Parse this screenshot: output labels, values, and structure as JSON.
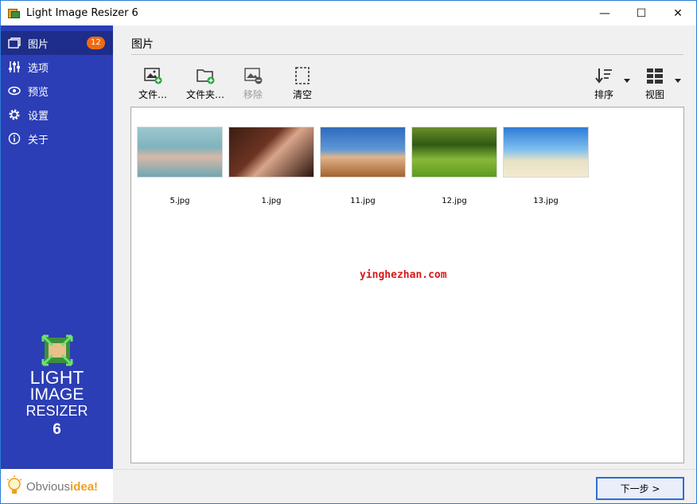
{
  "window": {
    "title": "Light Image Resizer 6",
    "controls": {
      "minimize": "—",
      "maximize": "☐",
      "close": "✕"
    }
  },
  "sidebar": {
    "items": [
      {
        "label": "图片",
        "icon": "images-icon",
        "badge": "12",
        "active": true
      },
      {
        "label": "选项",
        "icon": "sliders-icon"
      },
      {
        "label": "预览",
        "icon": "eye-icon"
      },
      {
        "label": "设置",
        "icon": "gear-icon"
      },
      {
        "label": "关于",
        "icon": "info-icon"
      }
    ],
    "logo": {
      "line1": "LIGHT",
      "line2": "IMAGE",
      "line3": "RESIZER",
      "line4": "6"
    },
    "footer": {
      "brand_prefix": "Obvious",
      "brand_accent": "idea!"
    }
  },
  "main": {
    "heading": "图片",
    "toolbar": {
      "add_files": "文件…",
      "add_folder": "文件夹…",
      "remove": "移除",
      "clear": "清空",
      "sort": "排序",
      "view": "视图"
    },
    "images": [
      {
        "name": "5.jpg"
      },
      {
        "name": "1.jpg"
      },
      {
        "name": "11.jpg"
      },
      {
        "name": "12.jpg"
      },
      {
        "name": "13.jpg"
      }
    ],
    "overlay_text": "yinghezhan.com",
    "next_button": "下一步 >"
  },
  "colors": {
    "sidebar_bg": "#2b3eb5",
    "sidebar_active": "#1e2d8a",
    "badge": "#ef6b12",
    "accent": "#2c6fd1"
  }
}
